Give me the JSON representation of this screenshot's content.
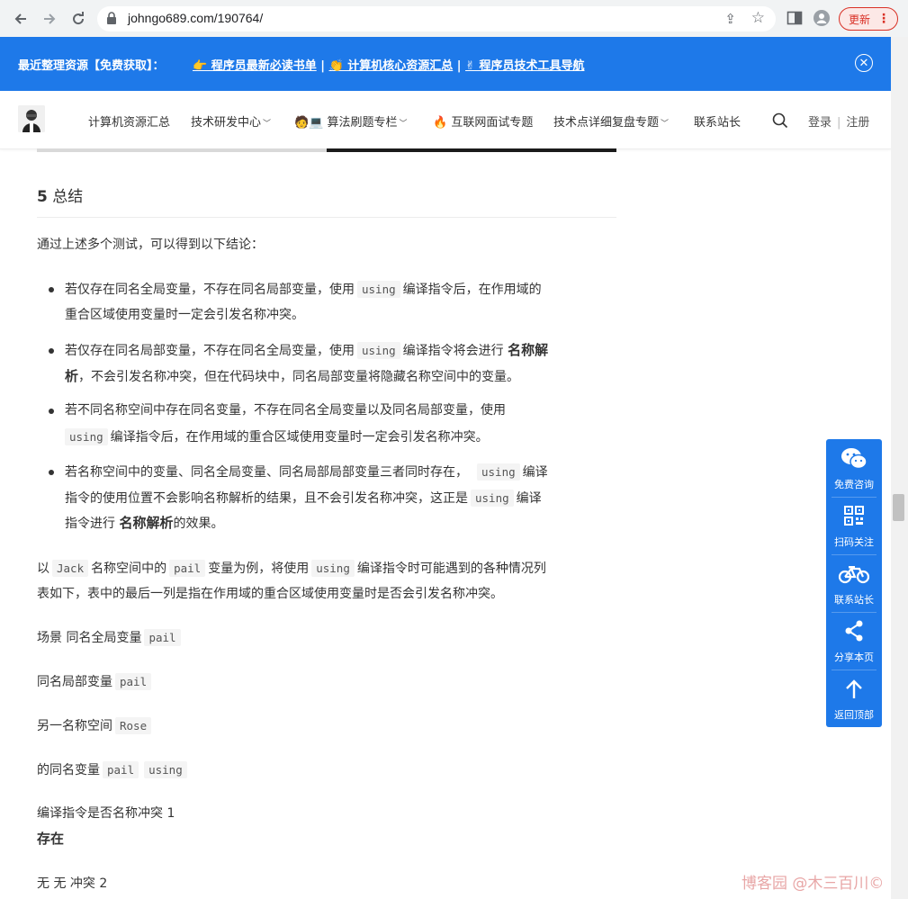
{
  "browser": {
    "url": "johngo689.com/190764/",
    "update_label": "更新",
    "menu_dots": "⋮"
  },
  "promo": {
    "lead": "最近整理资源【免费获取】：",
    "link1": "👉 程序员最新必读书单",
    "sep1": " | ",
    "link2": "👏 计算机核心资源汇总",
    "sep2": " | ",
    "link3": "✌ 程序员技术工具导航"
  },
  "header": {
    "menu": [
      "计算机资源汇总",
      "技术研发中心",
      "🧑💻 算法刷题专栏",
      "🔥 互联网面试专题",
      "技术点详细复盘专题",
      "联系站长"
    ],
    "login": "登录",
    "register": "注册"
  },
  "article": {
    "heading_num": "5",
    "heading_text": "总结",
    "intro": "通过上述多个测试，可以得到以下结论：",
    "li1_a": "若仅存在同名全局变量，不存在同名局部变量，使用",
    "li1_code": "using",
    "li1_b": "编译指令后，在作用域的",
    "li1_c": "重合区域使用变量时一定会引发名称冲突。",
    "li2_a": "若仅存在同名局部变量，不存在同名全局变量，使用",
    "li2_code": "using",
    "li2_b": "编译指令将会进行",
    "li2_strong1": "名称解",
    "li2_strong2": "析",
    "li2_c": "，不会引发名称冲突，但在代码块中，同名局部变量将隐藏名称空间中的变量。",
    "li3_a": "若不同名称空间中存在同名变量，不存在同名全局变量以及同名局部变量，使用",
    "li3_code": "using",
    "li3_b": "编译指令后，在作用域的重合区域使用变量时一定会引发名称冲突。",
    "li4_a": "若名称空间中的变量、同名全局变量、同名局部局部变量三者同时存在，",
    "li4_code1": "using",
    "li4_b": "编译",
    "li4_c": "指令的使用位置不会影响名称解析的结果，且不会引发名称冲突，这正是",
    "li4_code2": "using",
    "li4_d": "编译",
    "li4_e": "指令进行",
    "li4_strong": "名称解析",
    "li4_f": "的效果。",
    "para_a": "以",
    "para_code1": "Jack",
    "para_b": "名称空间中的",
    "para_code2": "pail",
    "para_c": "变量为例，将使用",
    "para_code3": "using",
    "para_d": "编译指令时可能遇到的各种情况列",
    "para_e": "表如下，表中的最后一列是指在作用域的重合区域使用变量时是否会引发名称冲突。",
    "t1_text": "场景 同名全局变量",
    "t1_code": "pail",
    "t2_text": "同名局部变量",
    "t2_code": "pail",
    "t3_text": "另一名称空间",
    "t3_code": "Rose",
    "t4_text": "的同名变量",
    "t4_code1": "pail",
    "t4_code2": "using",
    "t5_text": "编译指令是否名称冲突 1",
    "t6_text": "存在",
    "t7_text": "无 无 冲突 2"
  },
  "side_panel": {
    "items": [
      "免费咨询",
      "扫码关注",
      "联系站长",
      "分享本页",
      "返回顶部"
    ],
    "color": "#1e79e9"
  },
  "watermark": "博客园 @木三百川©"
}
